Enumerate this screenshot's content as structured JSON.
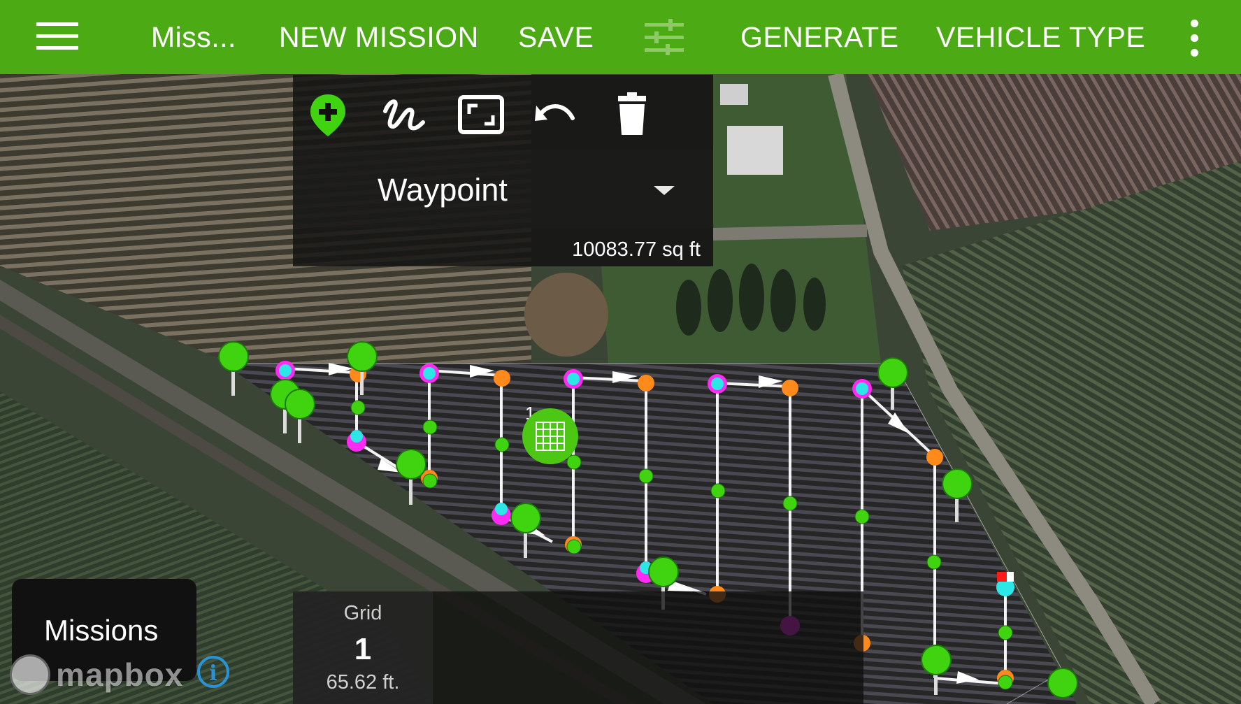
{
  "appbar": {
    "title": "Miss...",
    "new_mission": "NEW MISSION",
    "save": "SAVE",
    "generate": "GENERATE",
    "vehicle_type": "VEHICLE TYPE",
    "background_color": "#4caa14",
    "icons": [
      "menu-icon",
      "tune-icon",
      "more-vert-icon"
    ]
  },
  "draw_toolbar": {
    "tools": [
      "add-waypoint-icon",
      "draw-path-icon",
      "polygon-area-icon",
      "undo-icon",
      "delete-icon"
    ],
    "mode_select": "Waypoint",
    "area": "10083.77 sq ft"
  },
  "grid_info": {
    "label": "Grid",
    "number": "1",
    "spacing": "65.62 ft."
  },
  "grid_marker": {
    "number": "1"
  },
  "missions_button": "Missions",
  "attribution": {
    "logo_text": "mapbox",
    "info_icon": "i"
  },
  "colors": {
    "accent": "#4caa14",
    "waypoint_green": "#3fd40f",
    "start_magenta": "#ff2bf5",
    "cyan": "#2de6e6",
    "orange": "#ff8a1c"
  }
}
